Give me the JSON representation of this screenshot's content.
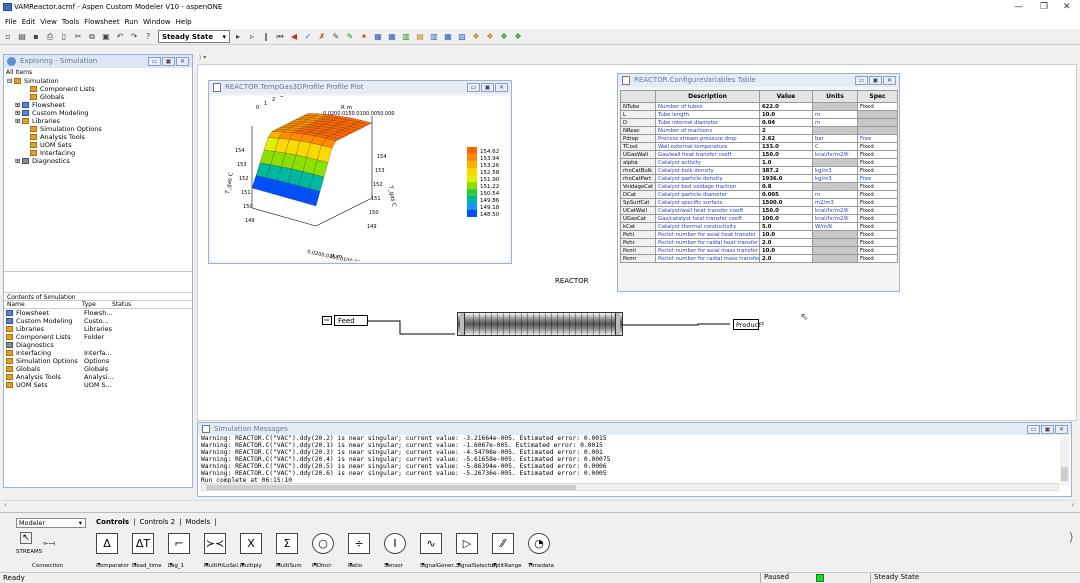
{
  "app": {
    "title": "VAMReactor.acmf - Aspen Custom Modeler V10 - aspenONE"
  },
  "menu": [
    "File",
    "Edit",
    "View",
    "Tools",
    "Flowsheet",
    "Run",
    "Window",
    "Help"
  ],
  "toolbar": {
    "run_mode": "Steady State"
  },
  "explorer": {
    "title": "Exploring - Simulation",
    "all_items": "All Items",
    "tree": [
      {
        "label": "Simulation",
        "depth": 0,
        "exp": "⊟"
      },
      {
        "label": "Component Lists",
        "depth": 2,
        "exp": ""
      },
      {
        "label": "Globals",
        "depth": 2,
        "exp": ""
      },
      {
        "label": "Flowsheet",
        "depth": 1,
        "exp": "⊞"
      },
      {
        "label": "Custom Modeling",
        "depth": 1,
        "exp": "⊞"
      },
      {
        "label": "Libraries",
        "depth": 1,
        "exp": "⊞"
      },
      {
        "label": "Simulation Options",
        "depth": 2,
        "exp": ""
      },
      {
        "label": "Analysis Tools",
        "depth": 2,
        "exp": ""
      },
      {
        "label": "UOM Sets",
        "depth": 2,
        "exp": ""
      },
      {
        "label": "Interfacing",
        "depth": 2,
        "exp": ""
      },
      {
        "label": "Diagnostics",
        "depth": 1,
        "exp": "⊞"
      }
    ],
    "contents_title": "Contents of Simulation",
    "columns": [
      "Name",
      "Type",
      "Status"
    ],
    "contents": [
      {
        "name": "Flowsheet",
        "type": "Flowsh..."
      },
      {
        "name": "Custom Modeling",
        "type": "Custo..."
      },
      {
        "name": "Libraries",
        "type": "Libraries"
      },
      {
        "name": "Component Lists",
        "type": "Folder"
      },
      {
        "name": "Diagnostics",
        "type": ""
      },
      {
        "name": "Interfacing",
        "type": "Interfa..."
      },
      {
        "name": "Simulation Options",
        "type": "Options"
      },
      {
        "name": "Globals",
        "type": "Globals"
      },
      {
        "name": "Analysis Tools",
        "type": "Analysi..."
      },
      {
        "name": "UOM Sets",
        "type": "UOM S..."
      }
    ]
  },
  "plot": {
    "title": "REACTOR.TempGas3DProfile Profile Plot",
    "axis_r": "R m",
    "axis_z": "Z m",
    "axis_t": "T_gas C",
    "z_ticks": [
      "7",
      "6",
      "5",
      "4",
      "3",
      "2",
      "1",
      "0"
    ],
    "r_ticks": "0.0200.0150.0100.0050.000",
    "t_ticks": [
      "154",
      "153",
      "152",
      "151",
      "150",
      "149"
    ],
    "legend": [
      "154.62",
      "153.94",
      "153.26",
      "152.58",
      "151.90",
      "151.22",
      "150.54",
      "149.86",
      "149.18",
      "148.50"
    ],
    "legend_colors": [
      "#ff6600",
      "#ff8c00",
      "#ffb300",
      "#ffd800",
      "#e0ef00",
      "#8ce000",
      "#2ecc40",
      "#00b8a0",
      "#1e90ff",
      "#0050ff"
    ]
  },
  "table": {
    "title": "REACTOR.ConfigureVariables Table",
    "columns": [
      "Description",
      "Value",
      "Units",
      "Spec"
    ],
    "rows": [
      {
        "n": "NTube",
        "d": "Number of tubes",
        "v": "622.0",
        "u": "",
        "s": "Fixed"
      },
      {
        "n": "L",
        "d": "Tube length",
        "v": "10.0",
        "u": "m",
        "s": ""
      },
      {
        "n": "D",
        "d": "Tube internal diameter",
        "v": "0.04",
        "u": "m",
        "s": ""
      },
      {
        "n": "NReac",
        "d": "Number of reactions",
        "v": "2",
        "u": "",
        "s": ""
      },
      {
        "n": "Pdrop",
        "d": "Process stream pressure drop",
        "v": "2.62",
        "u": "bar",
        "s": "Free"
      },
      {
        "n": "TCool",
        "d": "Wall external temperature",
        "v": "133.0",
        "u": "C",
        "s": "Fixed"
      },
      {
        "n": "UGasWall",
        "d": "Gas/wall heat transfer coeff.",
        "v": "150.0",
        "u": "kcal/hr/m2/K",
        "s": "Fixed"
      },
      {
        "n": "alpha",
        "d": "Catalyst activity",
        "v": "1.0",
        "u": "",
        "s": "Fixed"
      },
      {
        "n": "rhoCatBulk",
        "d": "Catalyst bulk density",
        "v": "387.2",
        "u": "kg/m3",
        "s": "Fixed"
      },
      {
        "n": "rhoCatPart",
        "d": "Catalyst particle density",
        "v": "1936.0",
        "u": "kg/m3",
        "s": "Free"
      },
      {
        "n": "VoidageCat",
        "d": "Catalyst bed voidage fraction",
        "v": "0.8",
        "u": "",
        "s": "Fixed"
      },
      {
        "n": "DCat",
        "d": "Catalyst particle diameter",
        "v": "0.005",
        "u": "m",
        "s": "Fixed"
      },
      {
        "n": "SpSurfCat",
        "d": "Catalyst specific surface",
        "v": "1500.0",
        "u": "m2/m3",
        "s": "Fixed"
      },
      {
        "n": "UCatWall",
        "d": "Catalyst/wall heat transfer coeff.",
        "v": "150.0",
        "u": "kcal/hr/m2/K",
        "s": "Fixed"
      },
      {
        "n": "UGasCat",
        "d": "Gas/catalyst heat transfer coeff.",
        "v": "100.0",
        "u": "kcal/hr/m2/K",
        "s": "Fixed"
      },
      {
        "n": "kCat",
        "d": "Catalyst thermal conductivity",
        "v": "5.0",
        "u": "W/m/K",
        "s": "Fixed"
      },
      {
        "n": "Pehl",
        "d": "Peclet number for axial heat transfer",
        "v": "10.0",
        "u": "",
        "s": "Fixed"
      },
      {
        "n": "Pehr",
        "d": "Peclet number for radial heat transfer",
        "v": "2.0",
        "u": "",
        "s": "Fixed"
      },
      {
        "n": "Peml",
        "d": "Peclet number for axial mass transfer",
        "v": "10.0",
        "u": "",
        "s": "Fixed"
      },
      {
        "n": "Pemr",
        "d": "Peclet number for radial mass transfer",
        "v": "2.0",
        "u": "",
        "s": "Fixed"
      }
    ]
  },
  "flowsheet": {
    "reactor_label": "REACTOR",
    "feed": "Feed",
    "product": "Product"
  },
  "messages": {
    "title": "Simulation Messages",
    "lines": [
      "Warning: REACTOR.C(\"VAC\").ddy(20.2) is near singular; current value: -3.21664e-005. Estimated error: 0.0015",
      "Warning: REACTOR.C(\"VAC\").ddy(20.1) is near singular; current value: -1.6067e-005. Estimated error: 0.0015",
      "Warning: REACTOR.C(\"VAC\").ddy(20.3) is near singular; current value: -4.54708e-005. Estimated error: 0.001",
      "Warning: REACTOR.C(\"VAC\").ddy(20.4) is near singular; current value: -5.61658e-005. Estimated error: 0.00075",
      "Warning: REACTOR.C(\"VAC\").ddy(20.5) is near singular; current value: -5.86394e-005. Estimated error: 0.0006",
      "Warning: REACTOR.C(\"VAC\").ddy(20.6) is near singular; current value: -5.26736e-005. Estimated error: 0.0005",
      "Run complete at 06:15:10"
    ]
  },
  "palette": {
    "library": "Modeler",
    "tabs": [
      "Controls",
      "Controls 2",
      "Models"
    ],
    "streams": "STREAMS",
    "items": [
      {
        "label": "Connection",
        "glyph": "⟜⟞"
      },
      {
        "label": "Comparator",
        "glyph": "Δ"
      },
      {
        "label": "Dead_time",
        "glyph": "ΔT"
      },
      {
        "label": "Lag_1",
        "glyph": "⌐"
      },
      {
        "label": "MultiHiLoSel...",
        "glyph": "≻≺"
      },
      {
        "label": "Multiply",
        "glyph": "X"
      },
      {
        "label": "MultiSum",
        "glyph": "Σ"
      },
      {
        "label": "PIDIncr",
        "glyph": "○"
      },
      {
        "label": "Ratio",
        "glyph": "÷"
      },
      {
        "label": "Sensor",
        "glyph": "I"
      },
      {
        "label": "SignalGener...",
        "glyph": "∿"
      },
      {
        "label": "SignalSelector",
        "glyph": "▷"
      },
      {
        "label": "SplitRange",
        "glyph": "⁄⁄"
      },
      {
        "label": "Timedata",
        "glyph": "◔"
      }
    ]
  },
  "status": {
    "left": "Ready",
    "run_state": "Paused",
    "mode": "Steady State"
  }
}
